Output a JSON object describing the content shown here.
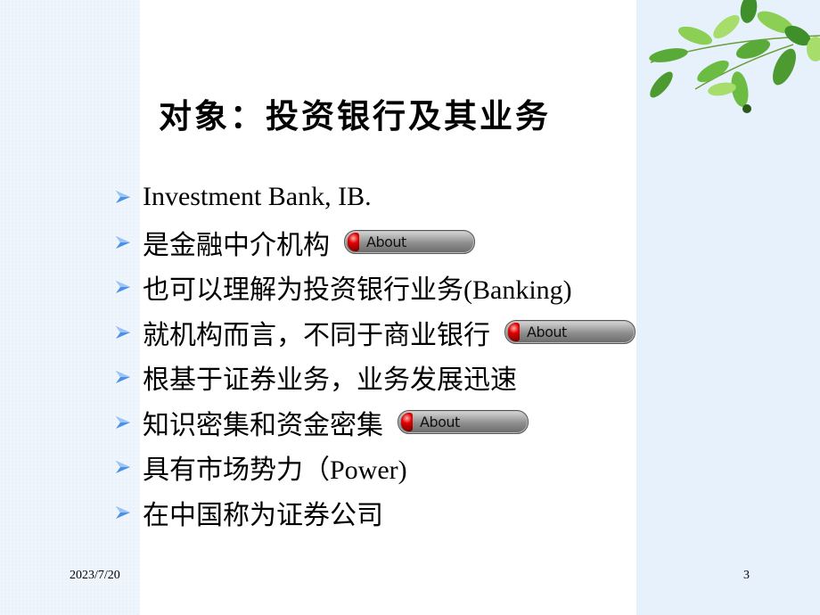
{
  "slide": {
    "title": "对象：投资银行及其业务",
    "bullets": [
      {
        "text": "Investment  Bank, IB.",
        "has_button": false
      },
      {
        "text": "是金融中介机构",
        "has_button": true
      },
      {
        "text": "也可以理解为投资银行业务(Banking)",
        "has_button": false
      },
      {
        "text": "就机构而言，不同于商业银行",
        "has_button": true
      },
      {
        "text": "根基于证券业务，业务发展迅速",
        "has_button": false
      },
      {
        "text": "知识密集和资金密集",
        "has_button": true
      },
      {
        "text": "具有市场势力（Power)",
        "has_button": false
      },
      {
        "text": "在中国称为证券公司",
        "has_button": false
      }
    ],
    "about_button_label": "About",
    "bullet_icon": "arrow-bullet-icon",
    "decoration_icon": "leaves-icon"
  },
  "footer": {
    "date": "2023/7/20",
    "page_number": "3"
  },
  "colors": {
    "left_panel": "#eef5fd",
    "right_panel": "#e6f1fc",
    "bullet_arrow": "#4a8fe8",
    "button_knob": "#e00000"
  }
}
